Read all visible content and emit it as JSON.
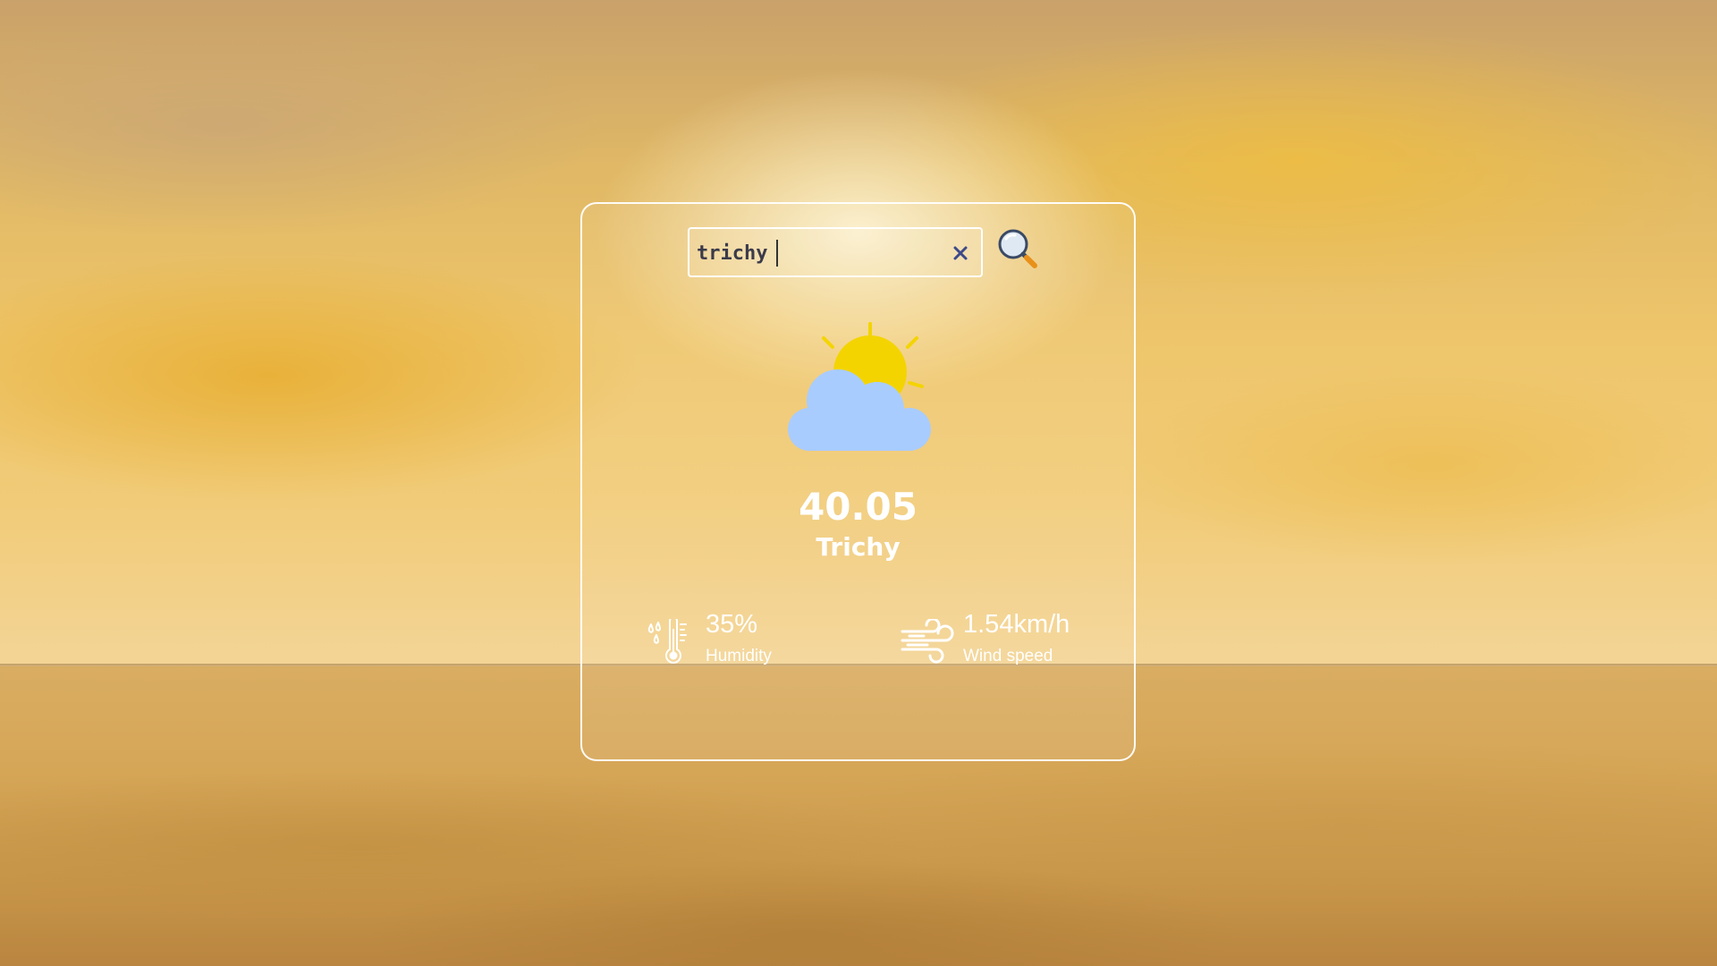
{
  "search": {
    "value": "trichy",
    "clear_icon": "close-icon",
    "search_icon": "magnifier-icon"
  },
  "weather": {
    "icon": "partly-cloudy-icon",
    "temperature": "40.05",
    "city": "Trichy"
  },
  "stats": {
    "humidity": {
      "icon": "humidity-thermometer-icon",
      "value": "35%",
      "label": "Humidity"
    },
    "wind": {
      "icon": "wind-icon",
      "value": "1.54km/h",
      "label": "Wind speed"
    }
  },
  "colors": {
    "card_border": "#ffffff",
    "text": "#ffffff",
    "sun": "#f4d400",
    "cloud": "#a9ccff",
    "clear_x": "#3c4a8a"
  }
}
